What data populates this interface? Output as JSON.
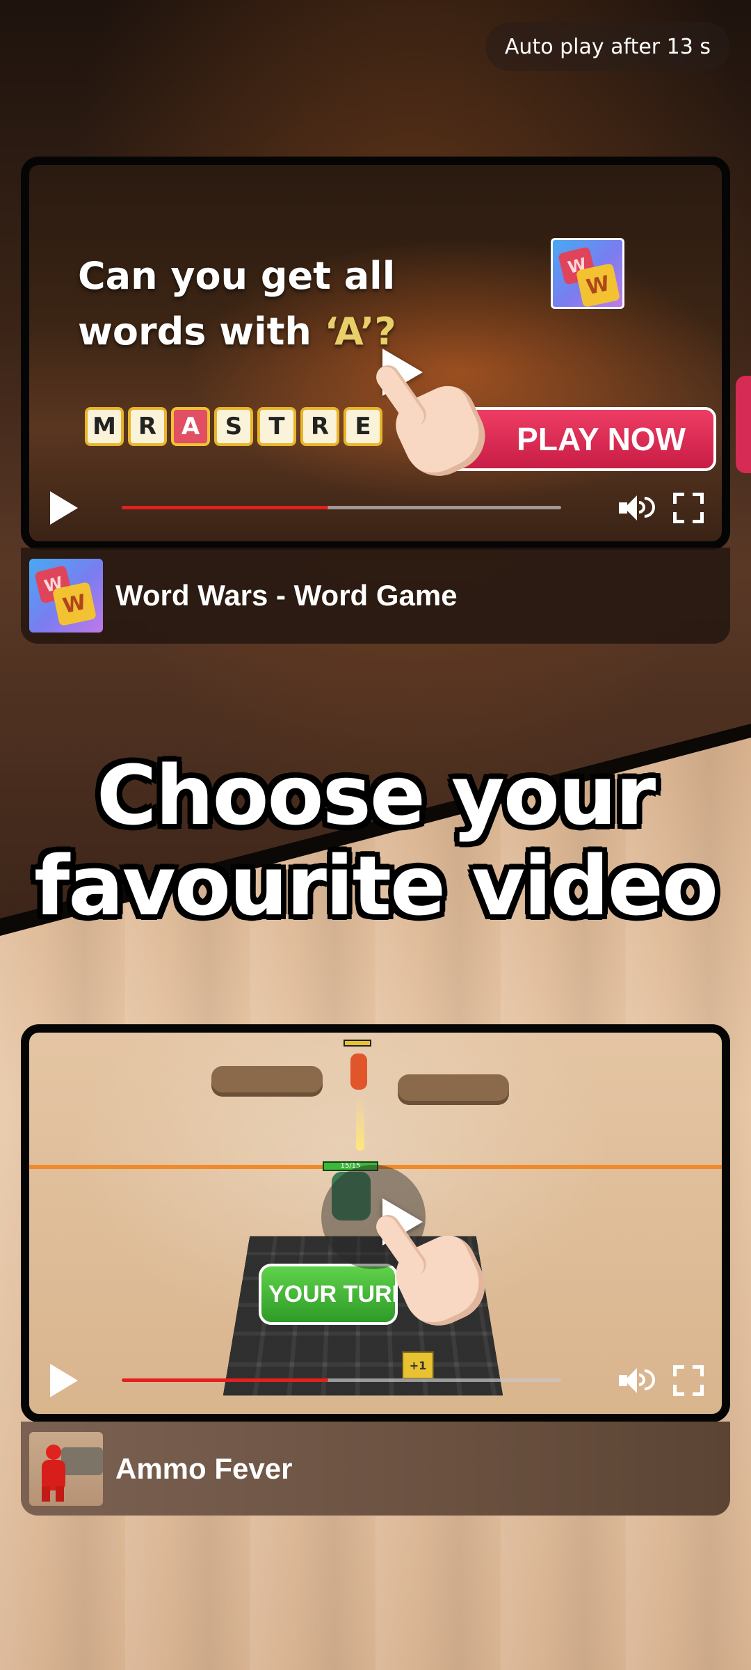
{
  "autoplay": {
    "text": "Auto play after 13 s"
  },
  "promo": {
    "line1": "Choose your",
    "line2": "favourite video"
  },
  "ads": [
    {
      "app_name": "Word Wars - Word Game",
      "icon": "word-wars-icon",
      "video": {
        "headline_line1": "Can you get all",
        "headline_line2_prefix": "words with ",
        "headline_line2_accent": "‘A’?",
        "letters": [
          "M",
          "R",
          "A",
          "S",
          "T",
          "R",
          "E"
        ],
        "highlighted_letter_index": 2,
        "cta": "PLAY NOW",
        "progress": 0.47
      }
    },
    {
      "app_name": "Ammo Fever",
      "icon": "ammo-fever-icon",
      "video": {
        "cta": "YOUR TURN",
        "hp_label": "15/15",
        "ammo_label": "+1",
        "progress": 0.47
      }
    }
  ],
  "colors": {
    "progress_fill": "#e3201c",
    "cta_red": "#d52b55",
    "your_turn_green": "#3fb834"
  }
}
